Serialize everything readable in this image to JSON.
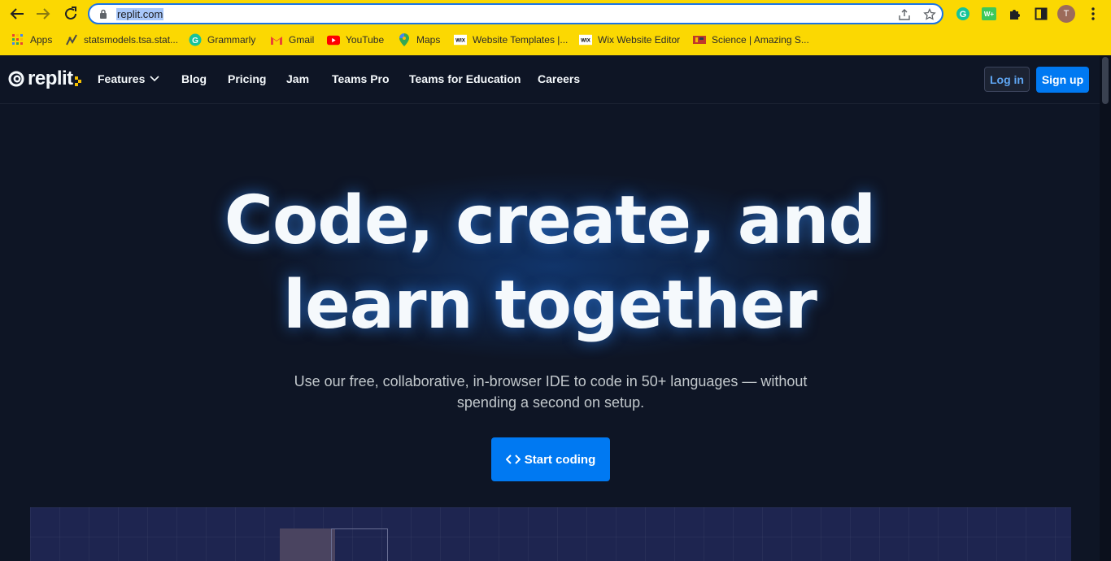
{
  "browser": {
    "url": "replit.com",
    "bookmarks": [
      {
        "label": "Apps",
        "icon": "apps-grid-icon"
      },
      {
        "label": "statsmodels.tsa.stat...",
        "icon": "statsmodels-icon"
      },
      {
        "label": "Grammarly",
        "icon": "grammarly-icon"
      },
      {
        "label": "Gmail",
        "icon": "gmail-icon"
      },
      {
        "label": "YouTube",
        "icon": "youtube-icon"
      },
      {
        "label": "Maps",
        "icon": "maps-pin-icon"
      },
      {
        "label": "Website Templates |...",
        "icon": "wix-icon"
      },
      {
        "label": "Wix Website Editor",
        "icon": "wix-icon"
      },
      {
        "label": "Science | Amazing S...",
        "icon": "science-icon"
      }
    ],
    "profile_initial": "T",
    "colors": {
      "toolbar": "#fbd802",
      "omnibox_border": "#1a73e8"
    }
  },
  "site": {
    "logo_text": "replit",
    "nav": {
      "features": "Features",
      "blog": "Blog",
      "pricing": "Pricing",
      "jam": "Jam",
      "teams_pro": "Teams Pro",
      "teams_edu": "Teams for Education",
      "careers": "Careers"
    },
    "login": "Log in",
    "signup": "Sign up",
    "hero": {
      "title_line1": "Code, create, and",
      "title_line2": "learn together",
      "subtitle_line1": "Use our free, collaborative, in-browser IDE to code in 50+ languages — without",
      "subtitle_line2": "spending a second on setup.",
      "cta": "Start coding"
    },
    "colors": {
      "background": "#0e1525",
      "primary": "#0079f2",
      "logo_accent": "#f5c000"
    }
  }
}
